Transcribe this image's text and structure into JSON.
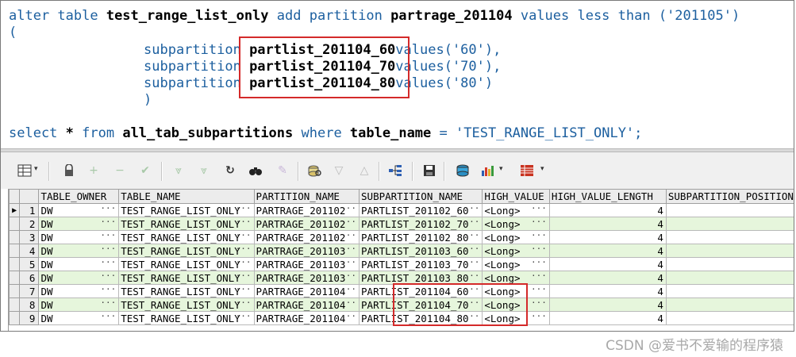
{
  "editor": {
    "line1": {
      "kw1": "alter table ",
      "b1": "test_range_list_only",
      "kw2": " add partition ",
      "b2": "partrage_201104",
      "kw3": " values less than ",
      "str": "('201105')"
    },
    "line2": "(",
    "subparts": [
      {
        "kw": "subpartition ",
        "name": "partlist_201104_60",
        "vals": "values('60'),"
      },
      {
        "kw": "subpartition ",
        "name": "partlist_201104_70",
        "vals": "values('70'),"
      },
      {
        "kw": "subpartition ",
        "name": "partlist_201104_80",
        "vals": "values('80')"
      }
    ],
    "close_paren": ")",
    "select": {
      "kw1": "select ",
      "b1": "*",
      "kw2": " from ",
      "b2": "all_tab_subpartitions",
      "kw3": " where ",
      "b3": "table_name",
      "eq": " = ",
      "str": "'TEST_RANGE_LIST_ONLY';"
    }
  },
  "toolbar": {
    "icons": [
      "grid-layout-icon",
      "lock-icon",
      "add-record-icon",
      "delete-record-icon",
      "post-edit-icon",
      "filter-icon",
      "clear-filter-icon",
      "refresh-icon",
      "find-icon",
      "clear-icon",
      "query-by-example-icon",
      "previous-icon",
      "next-icon",
      "explain-plan-icon",
      "save-icon",
      "export-icon",
      "chart-icon",
      "table-icon"
    ]
  },
  "grid": {
    "columns": [
      "TABLE_OWNER",
      "TABLE_NAME",
      "PARTITION_NAME",
      "SUBPARTITION_NAME",
      "HIGH_VALUE",
      "HIGH_VALUE_LENGTH",
      "SUBPARTITION_POSITION"
    ],
    "current_row_marker": "▶",
    "ellipsis": "···",
    "rows": [
      {
        "n": "1",
        "owner": "DW",
        "table": "TEST_RANGE_LIST_ONLY",
        "part": "PARTRAGE_201102",
        "subpart": "PARTLIST_201102_60",
        "hv": "<Long>",
        "hvl": "4"
      },
      {
        "n": "2",
        "owner": "DW",
        "table": "TEST_RANGE_LIST_ONLY",
        "part": "PARTRAGE_201102",
        "subpart": "PARTLIST_201102_70",
        "hv": "<Long>",
        "hvl": "4"
      },
      {
        "n": "3",
        "owner": "DW",
        "table": "TEST_RANGE_LIST_ONLY",
        "part": "PARTRAGE_201102",
        "subpart": "PARTLIST_201102_80",
        "hv": "<Long>",
        "hvl": "4"
      },
      {
        "n": "4",
        "owner": "DW",
        "table": "TEST_RANGE_LIST_ONLY",
        "part": "PARTRAGE_201103",
        "subpart": "PARTLIST_201103_60",
        "hv": "<Long>",
        "hvl": "4"
      },
      {
        "n": "5",
        "owner": "DW",
        "table": "TEST_RANGE_LIST_ONLY",
        "part": "PARTRAGE_201103",
        "subpart": "PARTLIST_201103_70",
        "hv": "<Long>",
        "hvl": "4"
      },
      {
        "n": "6",
        "owner": "DW",
        "table": "TEST_RANGE_LIST_ONLY",
        "part": "PARTRAGE_201103",
        "subpart": "PARTLIST_201103_80",
        "hv": "<Long>",
        "hvl": "4"
      },
      {
        "n": "7",
        "owner": "DW",
        "table": "TEST_RANGE_LIST_ONLY",
        "part": "PARTRAGE_201104",
        "subpart": "PARTLIST_201104_60",
        "hv": "<Long>",
        "hvl": "4"
      },
      {
        "n": "8",
        "owner": "DW",
        "table": "TEST_RANGE_LIST_ONLY",
        "part": "PARTRAGE_201104",
        "subpart": "PARTLIST_201104_70",
        "hv": "<Long>",
        "hvl": "4"
      },
      {
        "n": "9",
        "owner": "DW",
        "table": "TEST_RANGE_LIST_ONLY",
        "part": "PARTRAGE_201104",
        "subpart": "PARTLIST_201104_80",
        "hv": "<Long>",
        "hvl": "4"
      }
    ]
  },
  "watermark": "CSDN @爱书不爱输的程序猿",
  "colors": {
    "keyword": "#1c5f9f",
    "highlight": "#d42a2a",
    "alt_row": "#e6f6dc"
  }
}
